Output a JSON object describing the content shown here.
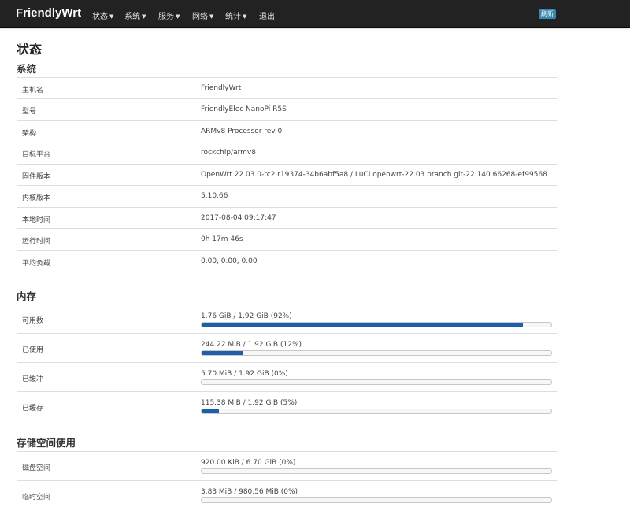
{
  "header": {
    "brand": "FriendlyWrt",
    "menu": [
      {
        "label": "状态",
        "has_caret": true
      },
      {
        "label": "系统",
        "has_caret": true
      },
      {
        "label": "服务",
        "has_caret": true
      },
      {
        "label": "网络",
        "has_caret": true
      },
      {
        "label": "统计",
        "has_caret": true
      },
      {
        "label": "退出",
        "has_caret": false
      }
    ],
    "refresh_label": "刷新"
  },
  "page_title": "状态",
  "system": {
    "title": "系统",
    "rows": [
      {
        "label": "主机名",
        "value": "FriendlyWrt"
      },
      {
        "label": "型号",
        "value": "FriendlyElec NanoPi R5S"
      },
      {
        "label": "架构",
        "value": "ARMv8 Processor rev 0"
      },
      {
        "label": "目标平台",
        "value": "rockchip/armv8"
      },
      {
        "label": "固件版本",
        "value": "OpenWrt 22.03.0-rc2 r19374-34b6abf5a8 / LuCI openwrt-22.03 branch git-22.140.66268-ef99568"
      },
      {
        "label": "内核版本",
        "value": "5.10.66"
      },
      {
        "label": "本地时间",
        "value": "2017-08-04 09:17:47"
      },
      {
        "label": "运行时间",
        "value": "0h 17m 46s"
      },
      {
        "label": "平均负载",
        "value": "0.00, 0.00, 0.00"
      }
    ]
  },
  "memory": {
    "title": "内存",
    "rows": [
      {
        "label": "可用数",
        "value": "1.76 GiB / 1.92 GiB (92%)",
        "percent": 92
      },
      {
        "label": "已使用",
        "value": "244.22 MiB / 1.92 GiB (12%)",
        "percent": 12
      },
      {
        "label": "已缓冲",
        "value": "5.70 MiB / 1.92 GiB (0%)",
        "percent": 0
      },
      {
        "label": "已缓存",
        "value": "115.38 MiB / 1.92 GiB (5%)",
        "percent": 5
      }
    ]
  },
  "storage": {
    "title": "存储空间使用",
    "rows": [
      {
        "label": "磁盘空间",
        "value": "920.00 KiB / 6.70 GiB (0%)",
        "percent": 0
      },
      {
        "label": "临时空间",
        "value": "3.83 MiB / 980.56 MiB (0%)",
        "percent": 0
      }
    ]
  },
  "colors": {
    "navbar": "#222222",
    "progress_fill": "#1f5ea8",
    "badge": "#3a87ad"
  }
}
